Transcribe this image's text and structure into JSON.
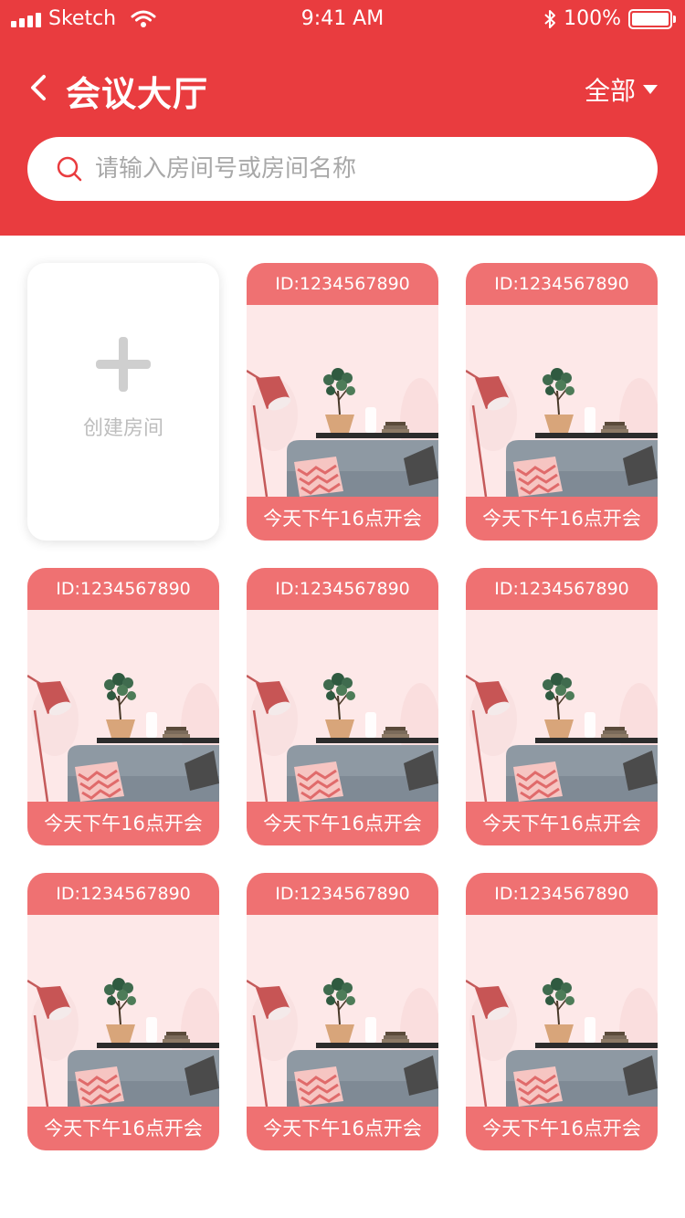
{
  "status_bar": {
    "carrier": "Sketch",
    "time": "9:41 AM",
    "battery": "100%"
  },
  "header": {
    "title": "会议大厅",
    "filter_label": "全部"
  },
  "search": {
    "placeholder": "请输入房间号或房间名称"
  },
  "create_card": {
    "label": "创建房间"
  },
  "rooms": [
    {
      "id": "ID:1234567890",
      "time": "今天下午16点开会"
    },
    {
      "id": "ID:1234567890",
      "time": "今天下午16点开会"
    },
    {
      "id": "ID:1234567890",
      "time": "今天下午16点开会"
    },
    {
      "id": "ID:1234567890",
      "time": "今天下午16点开会"
    },
    {
      "id": "ID:1234567890",
      "time": "今天下午16点开会"
    },
    {
      "id": "ID:1234567890",
      "time": "今天下午16点开会"
    },
    {
      "id": "ID:1234567890",
      "time": "今天下午16点开会"
    },
    {
      "id": "ID:1234567890",
      "time": "今天下午16点开会"
    }
  ],
  "colors": {
    "header_bg": "#e93c3f",
    "card_accent": "#ef7172",
    "card_bg": "#fde8e8"
  }
}
